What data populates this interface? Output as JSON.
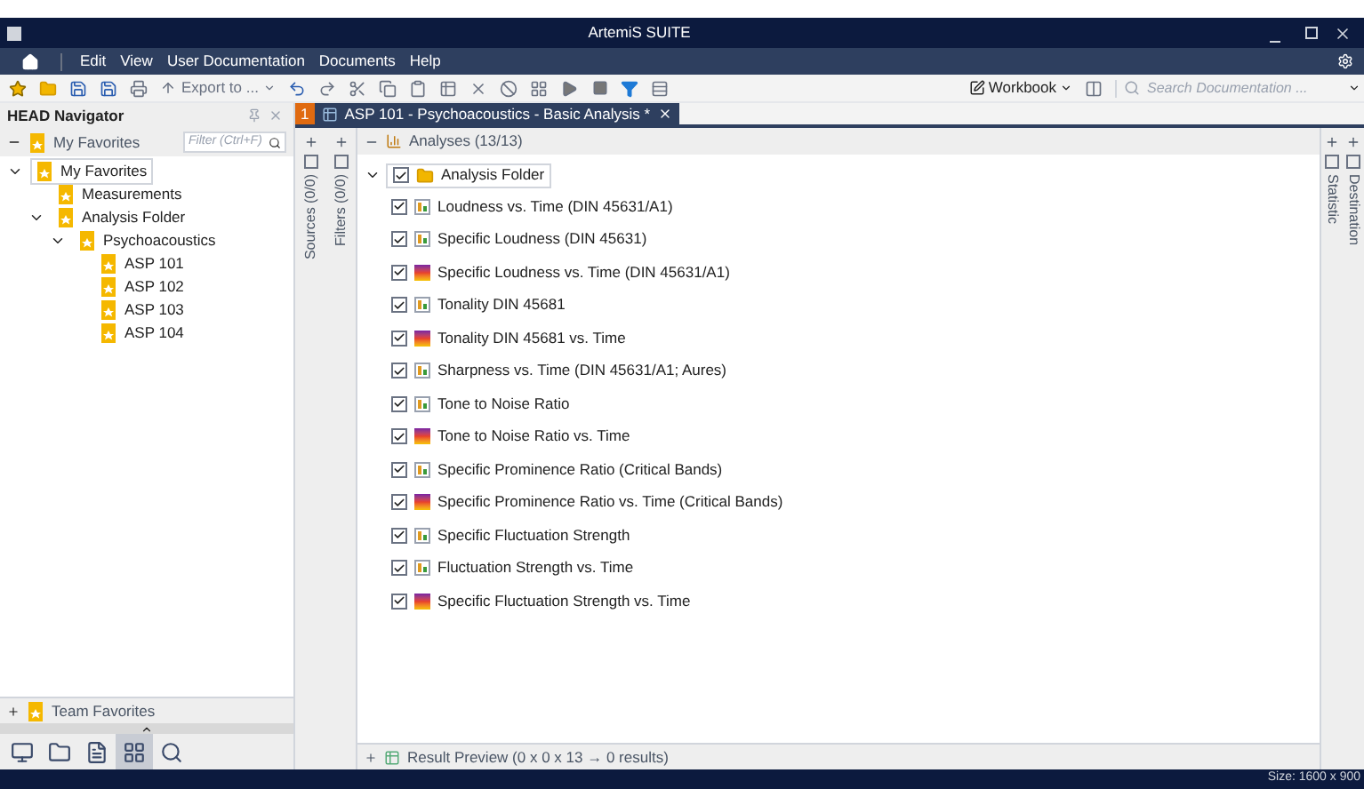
{
  "title_bar": {
    "title": "ArtemiS SUITE"
  },
  "menu": [
    "Edit",
    "View",
    "User Documentation",
    "Documents",
    "Help"
  ],
  "toolbar": {
    "export_label": "Export to ...",
    "workbook_label": "Workbook",
    "search_placeholder": "Search Documentation ..."
  },
  "navigator": {
    "title": "HEAD Navigator",
    "favorites_label": "My Favorites",
    "filter_placeholder": "Filter (Ctrl+F)",
    "tree": [
      {
        "label": "My Favorites",
        "expanded": true,
        "selected": true,
        "children": [
          {
            "label": "Measurements",
            "selected": false
          },
          {
            "label": "Analysis Folder",
            "expanded": true,
            "selected": false,
            "children": [
              {
                "label": "Psychoacoustics",
                "expanded": true,
                "selected": false,
                "children": [
                  {
                    "label": "ASP 101",
                    "selected": false
                  },
                  {
                    "label": "ASP 102",
                    "selected": false
                  },
                  {
                    "label": "ASP 103",
                    "selected": false
                  },
                  {
                    "label": "ASP 104",
                    "selected": false
                  }
                ]
              }
            ]
          }
        ]
      }
    ],
    "team_favorites": "Team Favorites",
    "bottom_tabs": [
      {
        "kind": "monitor",
        "selected": false
      },
      {
        "kind": "folder",
        "selected": false
      },
      {
        "kind": "document",
        "selected": false
      },
      {
        "kind": "grid",
        "selected": true
      },
      {
        "kind": "search",
        "selected": false
      }
    ]
  },
  "document_tab": {
    "number": "1",
    "title": "ASP 101 - Psychoacoustics - Basic Analysis *"
  },
  "side_strip": {
    "sources": "Sources (0/0)",
    "filters": "Filters (0/0)"
  },
  "analyses": {
    "header": "Analyses (13/13)",
    "folder": {
      "label": "Analysis Folder",
      "checked": true,
      "expanded": true,
      "children": [
        {
          "label": "Loudness vs. Time (DIN 45631/A1)",
          "checked": true,
          "kind": "bar"
        },
        {
          "label": "Specific Loudness (DIN 45631)",
          "checked": true,
          "kind": "bar"
        },
        {
          "label": "Specific Loudness vs. Time (DIN 45631/A1)",
          "checked": true,
          "kind": "heat"
        },
        {
          "label": "Tonality DIN 45681",
          "checked": true,
          "kind": "bar"
        },
        {
          "label": "Tonality DIN 45681 vs. Time",
          "checked": true,
          "kind": "heat"
        },
        {
          "label": "Sharpness vs. Time (DIN 45631/A1; Aures)",
          "checked": true,
          "kind": "bar"
        },
        {
          "label": "Tone to Noise Ratio",
          "checked": true,
          "kind": "bar"
        },
        {
          "label": "Tone to Noise Ratio vs. Time",
          "checked": true,
          "kind": "heat"
        },
        {
          "label": "Specific Prominence Ratio (Critical Bands)",
          "checked": true,
          "kind": "bar"
        },
        {
          "label": "Specific Prominence Ratio vs. Time (Critical Bands)",
          "checked": true,
          "kind": "heat"
        },
        {
          "label": "Specific Fluctuation Strength",
          "checked": true,
          "kind": "bar"
        },
        {
          "label": "Fluctuation Strength vs. Time",
          "checked": true,
          "kind": "bar"
        },
        {
          "label": "Specific Fluctuation Strength vs. Time",
          "checked": true,
          "kind": "heat"
        }
      ]
    }
  },
  "right_strip": [
    "Statistic",
    "Destination"
  ],
  "result_preview": "Result Preview (0 x 0 x 13 → 0 results)",
  "status_bar": {
    "size": "Size: 1600 x 900"
  }
}
